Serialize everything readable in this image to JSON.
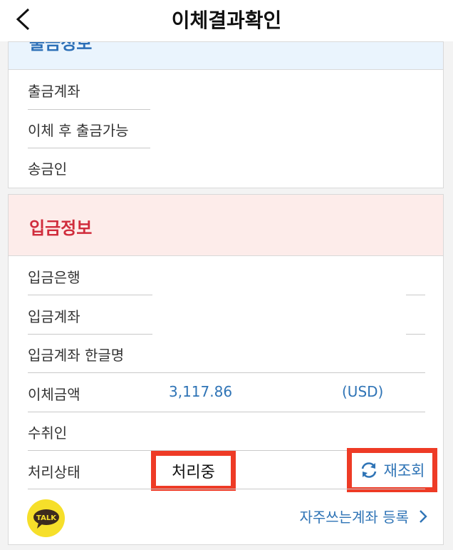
{
  "header": {
    "title": "이체결과확인"
  },
  "withdrawal": {
    "section_title": "출금정보",
    "rows": [
      "출금계좌",
      "이체 후 출금가능",
      "송금인"
    ]
  },
  "deposit": {
    "section_title": "입금정보",
    "bank_label": "입금은행",
    "account_label": "입금계좌",
    "holder_label": "입금계좌 한글명",
    "amount_label": "이체금액",
    "amount_value": "3,117.86",
    "currency": "(USD)",
    "recipient_label": "수취인",
    "status_label": "처리상태",
    "status_value": "처리중",
    "reload_label": "재조회"
  },
  "footer": {
    "talk_icon_text": "TALK",
    "favorite_label": "자주쓰는계좌 등록"
  },
  "colors": {
    "accent_blue": "#2f74b6",
    "section_red": "#d02c3c",
    "highlight_red": "#ee3b26",
    "talk_yellow": "#f6df2a"
  }
}
